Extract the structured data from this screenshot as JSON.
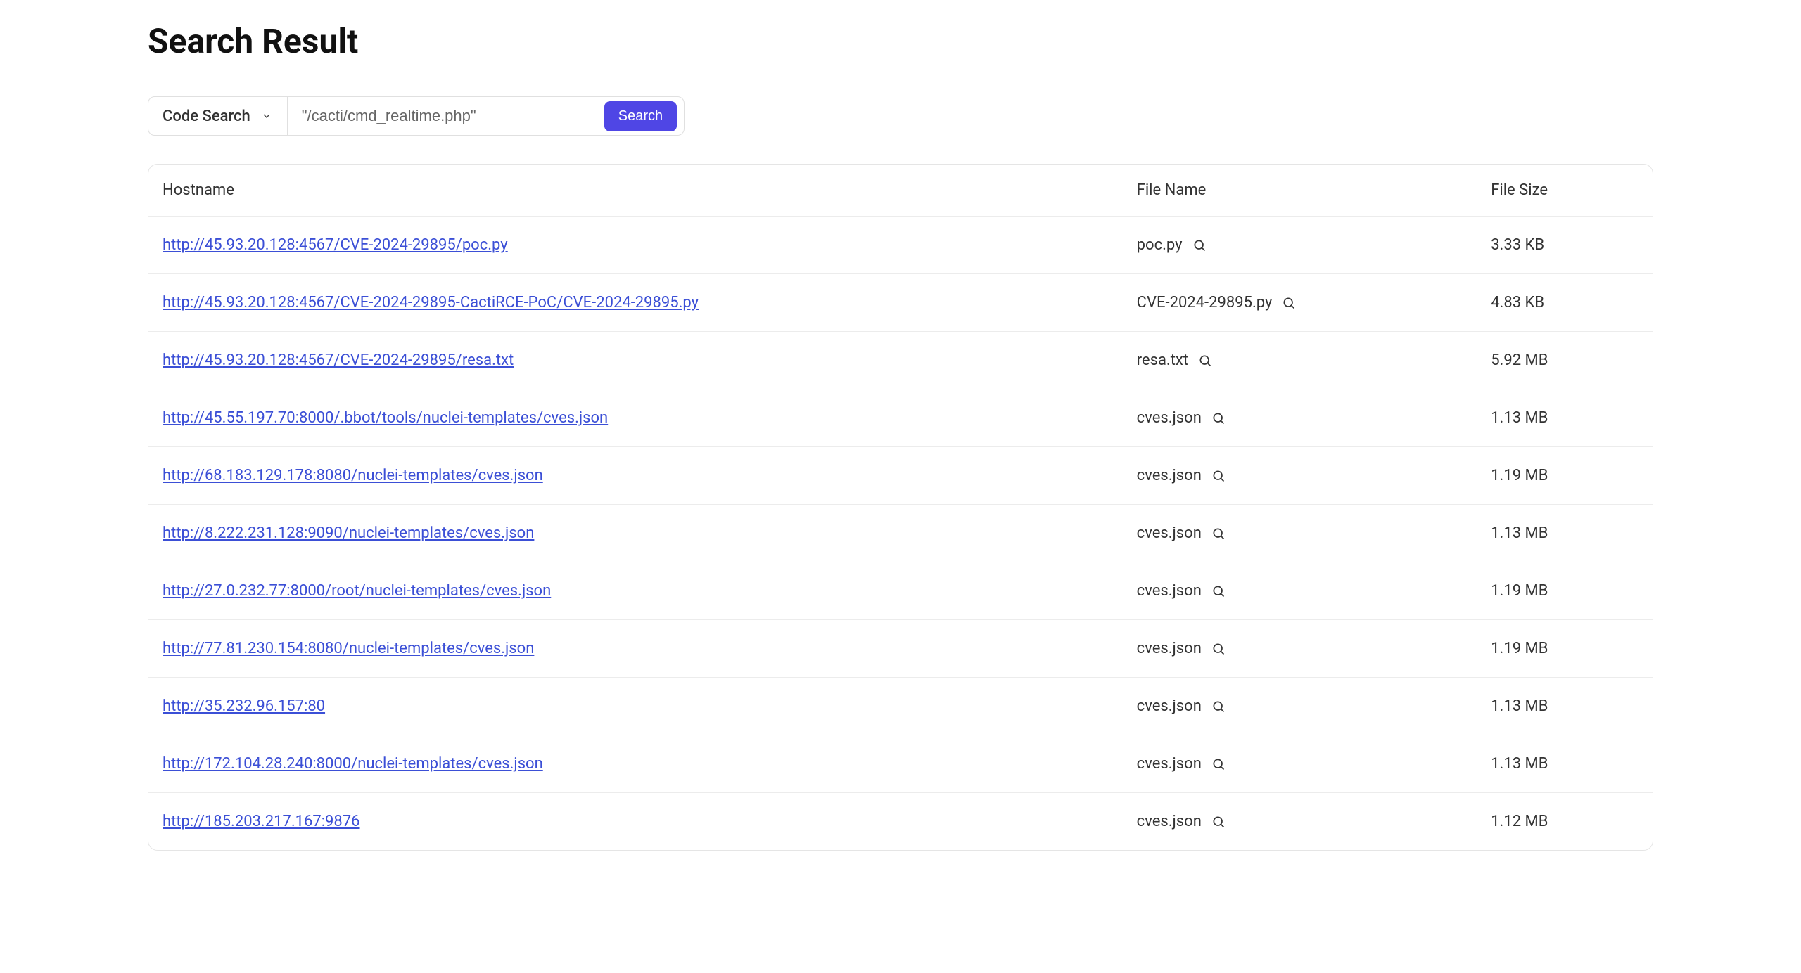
{
  "page": {
    "title": "Search Result"
  },
  "search": {
    "type_label": "Code Search",
    "query": "\"/cacti/cmd_realtime.php\"",
    "button_label": "Search"
  },
  "table": {
    "headers": {
      "hostname": "Hostname",
      "filename": "File Name",
      "filesize": "File Size"
    },
    "rows": [
      {
        "hostname": "http://45.93.20.128:4567/CVE-2024-29895/poc.py",
        "filename": "poc.py",
        "filesize": "3.33 KB"
      },
      {
        "hostname": "http://45.93.20.128:4567/CVE-2024-29895-CactiRCE-PoC/CVE-2024-29895.py",
        "filename": "CVE-2024-29895.py",
        "filesize": "4.83 KB"
      },
      {
        "hostname": "http://45.93.20.128:4567/CVE-2024-29895/resa.txt",
        "filename": "resa.txt",
        "filesize": "5.92 MB"
      },
      {
        "hostname": "http://45.55.197.70:8000/.bbot/tools/nuclei-templates/cves.json",
        "filename": "cves.json",
        "filesize": "1.13 MB"
      },
      {
        "hostname": "http://68.183.129.178:8080/nuclei-templates/cves.json",
        "filename": "cves.json",
        "filesize": "1.19 MB"
      },
      {
        "hostname": "http://8.222.231.128:9090/nuclei-templates/cves.json",
        "filename": "cves.json",
        "filesize": "1.13 MB"
      },
      {
        "hostname": "http://27.0.232.77:8000/root/nuclei-templates/cves.json",
        "filename": "cves.json",
        "filesize": "1.19 MB"
      },
      {
        "hostname": "http://77.81.230.154:8080/nuclei-templates/cves.json",
        "filename": "cves.json",
        "filesize": "1.19 MB"
      },
      {
        "hostname": "http://35.232.96.157:80",
        "filename": "cves.json",
        "filesize": "1.13 MB"
      },
      {
        "hostname": "http://172.104.28.240:8000/nuclei-templates/cves.json",
        "filename": "cves.json",
        "filesize": "1.13 MB"
      },
      {
        "hostname": "http://185.203.217.167:9876",
        "filename": "cves.json",
        "filesize": "1.12 MB"
      }
    ]
  }
}
